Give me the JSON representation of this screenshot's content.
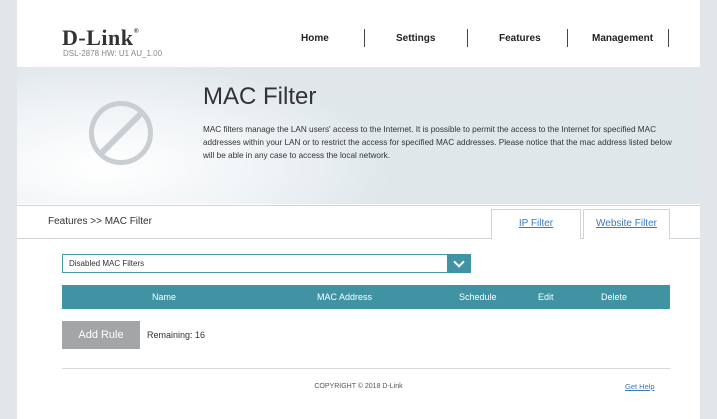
{
  "header": {
    "logo": "D-Link",
    "logo_tm": "®",
    "model_info": "DSL-2878  HW: U1  AU_1.00",
    "nav": [
      "Home",
      "Settings",
      "Features",
      "Management"
    ]
  },
  "banner": {
    "title": "MAC Filter",
    "description": "MAC filters manage the LAN users' access to the Internet. It is possible to permit the access to the Internet for specified MAC addresses within your LAN or to restrict the access for specified MAC addresses. Please notice that the mac address listed below will be able in any case to access the local network."
  },
  "breadcrumb": "Features >> MAC Filter",
  "tabs": [
    "IP Filter",
    "Website Filter"
  ],
  "filter_select": {
    "value": "Disabled MAC Filters"
  },
  "table": {
    "columns": [
      "Name",
      "MAC Address",
      "Schedule",
      "Edit",
      "Delete"
    ]
  },
  "add_rule_label": "Add Rule",
  "remaining_label": "Remaining: 16",
  "footer": {
    "copyright": "COPYRIGHT © 2018 D-Link",
    "help": "Get Help"
  }
}
